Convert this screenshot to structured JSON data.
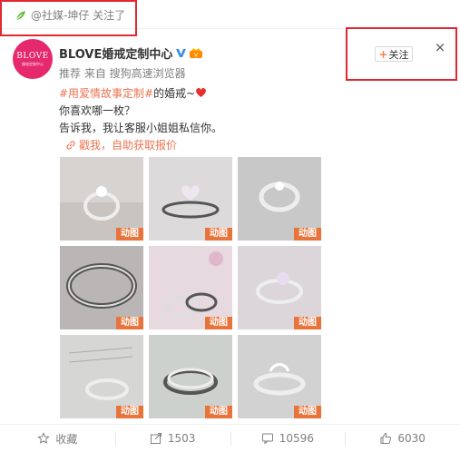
{
  "topbar": {
    "notice": "@社媒-坤仔 关注了"
  },
  "post": {
    "avatar_text": "BLOVE",
    "avatar_subtext": "婚戒定制中心",
    "author_name": "BLOVE婚戒定制中心",
    "meta_label": "推荐 来自 ",
    "meta_source": "搜狗高速浏览器",
    "follow_label": "关注",
    "close_label": "×",
    "content": {
      "tag": "#用爱情故事定制#",
      "line1_rest": "的婚戒~",
      "line2": "你喜欢哪一枚？",
      "line3": "告诉我，我让客服小姐姐私信你。"
    },
    "link_text": "戳我，自助获取报价",
    "gif_badge": "动图",
    "images": [
      {
        "name": "ring-1"
      },
      {
        "name": "ring-2"
      },
      {
        "name": "ring-3"
      },
      {
        "name": "ring-4"
      },
      {
        "name": "ring-5"
      },
      {
        "name": "ring-6"
      },
      {
        "name": "ring-7"
      },
      {
        "name": "ring-8"
      },
      {
        "name": "ring-9"
      }
    ]
  },
  "actions": {
    "favorite": "收藏",
    "repost": "1503",
    "comment": "10596",
    "like": "6030"
  },
  "colors": {
    "accent": "#eb7350",
    "highlight_box": "#e3262f",
    "badge": "#e8743b",
    "brand_pink": "#e6286d"
  }
}
